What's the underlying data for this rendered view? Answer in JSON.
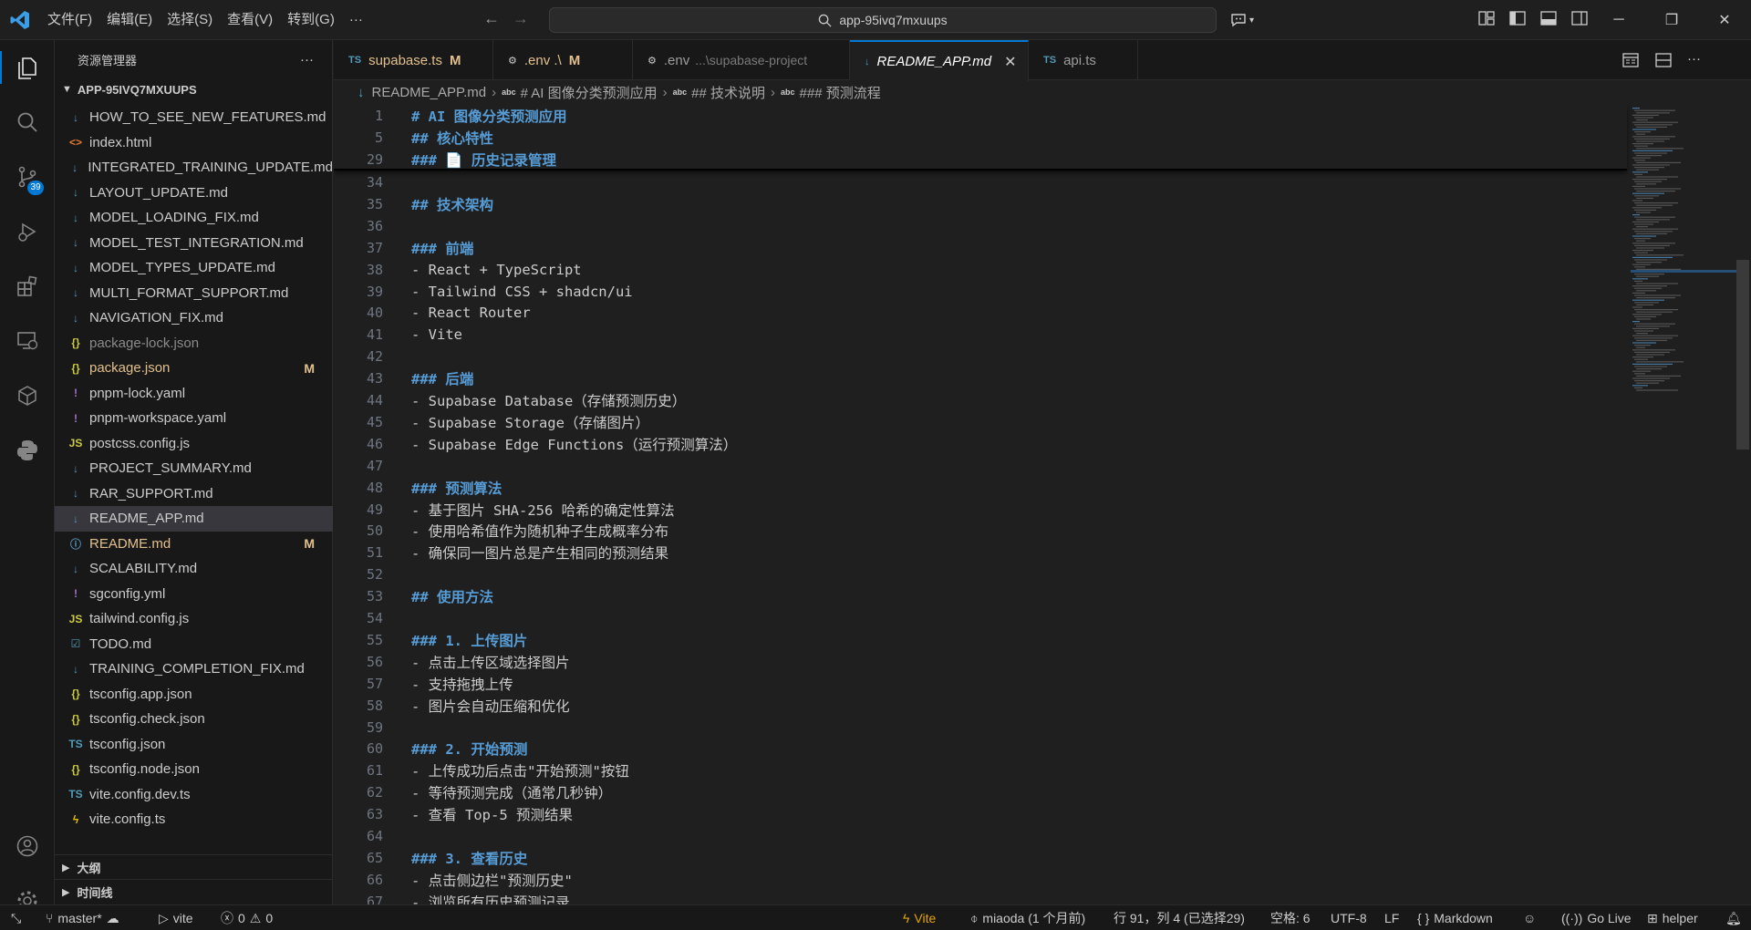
{
  "titlebar": {
    "menu": [
      "文件(F)",
      "编辑(E)",
      "选择(S)",
      "查看(V)",
      "转到(G)",
      "···"
    ],
    "search": "app-95ivq7mxuups"
  },
  "activity": {
    "scm_badge": "39"
  },
  "sidebar": {
    "title": "资源管理器",
    "more": "···",
    "root": "APP-95IVQ7MXUUPS",
    "files": [
      {
        "name": "HOW_TO_SEE_NEW_FEATURES.md",
        "icon": "↓",
        "icon_color": "#519aba"
      },
      {
        "name": "index.html",
        "icon": "<>",
        "icon_color": "#e37933"
      },
      {
        "name": "INTEGRATED_TRAINING_UPDATE.md",
        "icon": "↓",
        "icon_color": "#519aba"
      },
      {
        "name": "LAYOUT_UPDATE.md",
        "icon": "↓",
        "icon_color": "#519aba"
      },
      {
        "name": "MODEL_LOADING_FIX.md",
        "icon": "↓",
        "icon_color": "#519aba"
      },
      {
        "name": "MODEL_TEST_INTEGRATION.md",
        "icon": "↓",
        "icon_color": "#519aba"
      },
      {
        "name": "MODEL_TYPES_UPDATE.md",
        "icon": "↓",
        "icon_color": "#519aba"
      },
      {
        "name": "MULTI_FORMAT_SUPPORT.md",
        "icon": "↓",
        "icon_color": "#519aba"
      },
      {
        "name": "NAVIGATION_FIX.md",
        "icon": "↓",
        "icon_color": "#519aba"
      },
      {
        "name": "package-lock.json",
        "icon": "{}",
        "icon_color": "#cbcb41",
        "dim": true
      },
      {
        "name": "package.json",
        "icon": "{}",
        "icon_color": "#cbcb41",
        "mark": "M"
      },
      {
        "name": "pnpm-lock.yaml",
        "icon": "!",
        "icon_color": "#a074c4"
      },
      {
        "name": "pnpm-workspace.yaml",
        "icon": "!",
        "icon_color": "#a074c4"
      },
      {
        "name": "postcss.config.js",
        "icon": "JS",
        "icon_color": "#cbcb41"
      },
      {
        "name": "PROJECT_SUMMARY.md",
        "icon": "↓",
        "icon_color": "#519aba"
      },
      {
        "name": "RAR_SUPPORT.md",
        "icon": "↓",
        "icon_color": "#519aba"
      },
      {
        "name": "README_APP.md",
        "icon": "↓",
        "icon_color": "#519aba",
        "selected": true
      },
      {
        "name": "README.md",
        "icon": "ⓘ",
        "icon_color": "#519aba",
        "mark": "M"
      },
      {
        "name": "SCALABILITY.md",
        "icon": "↓",
        "icon_color": "#519aba"
      },
      {
        "name": "sgconfig.yml",
        "icon": "!",
        "icon_color": "#a074c4"
      },
      {
        "name": "tailwind.config.js",
        "icon": "JS",
        "icon_color": "#cbcb41"
      },
      {
        "name": "TODO.md",
        "icon": "☑",
        "icon_color": "#519aba"
      },
      {
        "name": "TRAINING_COMPLETION_FIX.md",
        "icon": "↓",
        "icon_color": "#519aba"
      },
      {
        "name": "tsconfig.app.json",
        "icon": "{}",
        "icon_color": "#cbcb41"
      },
      {
        "name": "tsconfig.check.json",
        "icon": "{}",
        "icon_color": "#cbcb41"
      },
      {
        "name": "tsconfig.json",
        "icon": "TS",
        "icon_color": "#519aba"
      },
      {
        "name": "tsconfig.node.json",
        "icon": "{}",
        "icon_color": "#cbcb41"
      },
      {
        "name": "vite.config.dev.ts",
        "icon": "TS",
        "icon_color": "#519aba"
      },
      {
        "name": "vite.config.ts",
        "icon": "ϟ",
        "icon_color": "#e5c100"
      }
    ],
    "outline": "大纲",
    "timeline": "时间线"
  },
  "tabs": [
    {
      "icon": "TS",
      "name": "supabase.ts",
      "mark": "M",
      "modified": true
    },
    {
      "icon": "⚙",
      "name": ".env .\\",
      "mark": "M",
      "modified": true
    },
    {
      "icon": "⚙",
      "name": ".env",
      "path": "...\\supabase-project"
    },
    {
      "icon": "↓",
      "name": "README_APP.md",
      "active": true
    },
    {
      "icon": "TS",
      "name": "api.ts"
    }
  ],
  "breadcrumb": [
    "README_APP.md",
    "# AI 图像分类预测应用",
    "## 技术说明",
    "### 预测流程"
  ],
  "sticky_lines": [
    {
      "n": "1",
      "t": "# AI 图像分类预测应用",
      "h": true
    },
    {
      "n": "5",
      "t": "## 核心特性",
      "h": true
    },
    {
      "n": "29",
      "t": "### 📄 历史记录管理",
      "h": true
    }
  ],
  "lines": [
    {
      "n": "34",
      "t": ""
    },
    {
      "n": "35",
      "t": "## 技术架构",
      "h": true
    },
    {
      "n": "36",
      "t": ""
    },
    {
      "n": "37",
      "t": "### 前端",
      "h": true
    },
    {
      "n": "38",
      "t": "- React + TypeScript"
    },
    {
      "n": "39",
      "t": "- Tailwind CSS + shadcn/ui"
    },
    {
      "n": "40",
      "t": "- React Router"
    },
    {
      "n": "41",
      "t": "- Vite"
    },
    {
      "n": "42",
      "t": ""
    },
    {
      "n": "43",
      "t": "### 后端",
      "h": true
    },
    {
      "n": "44",
      "t": "- Supabase Database（存储预测历史）"
    },
    {
      "n": "45",
      "t": "- Supabase Storage（存储图片）"
    },
    {
      "n": "46",
      "t": "- Supabase Edge Functions（运行预测算法）"
    },
    {
      "n": "47",
      "t": ""
    },
    {
      "n": "48",
      "t": "### 预测算法",
      "h": true
    },
    {
      "n": "49",
      "t": "- 基于图片 SHA-256 哈希的确定性算法"
    },
    {
      "n": "50",
      "t": "- 使用哈希值作为随机种子生成概率分布"
    },
    {
      "n": "51",
      "t": "- 确保同一图片总是产生相同的预测结果"
    },
    {
      "n": "52",
      "t": ""
    },
    {
      "n": "53",
      "t": "## 使用方法",
      "h": true
    },
    {
      "n": "54",
      "t": ""
    },
    {
      "n": "55",
      "t": "### 1. 上传图片",
      "h": true
    },
    {
      "n": "56",
      "t": "- 点击上传区域选择图片"
    },
    {
      "n": "57",
      "t": "- 支持拖拽上传"
    },
    {
      "n": "58",
      "t": "- 图片会自动压缩和优化"
    },
    {
      "n": "59",
      "t": ""
    },
    {
      "n": "60",
      "t": "### 2. 开始预测",
      "h": true
    },
    {
      "n": "61",
      "t": "- 上传成功后点击\"开始预测\"按钮"
    },
    {
      "n": "62",
      "t": "- 等待预测完成（通常几秒钟）"
    },
    {
      "n": "63",
      "t": "- 查看 Top-5 预测结果"
    },
    {
      "n": "64",
      "t": ""
    },
    {
      "n": "65",
      "t": "### 3. 查看历史",
      "h": true
    },
    {
      "n": "66",
      "t": "- 点击侧边栏\"预测历史\""
    },
    {
      "n": "67",
      "t": "- 浏览所有历史预测记录"
    }
  ],
  "status": {
    "branch": "master*",
    "run": "vite",
    "errors": "0",
    "warnings": "0",
    "vite": "Vite",
    "blame": "miaoda (1 个月前)",
    "position": "行 91，列 4 (已选择29)",
    "spaces": "空格: 6",
    "encoding": "UTF-8",
    "eol": "LF",
    "language": "Markdown",
    "golive": "Go Live",
    "helper": "helper"
  }
}
